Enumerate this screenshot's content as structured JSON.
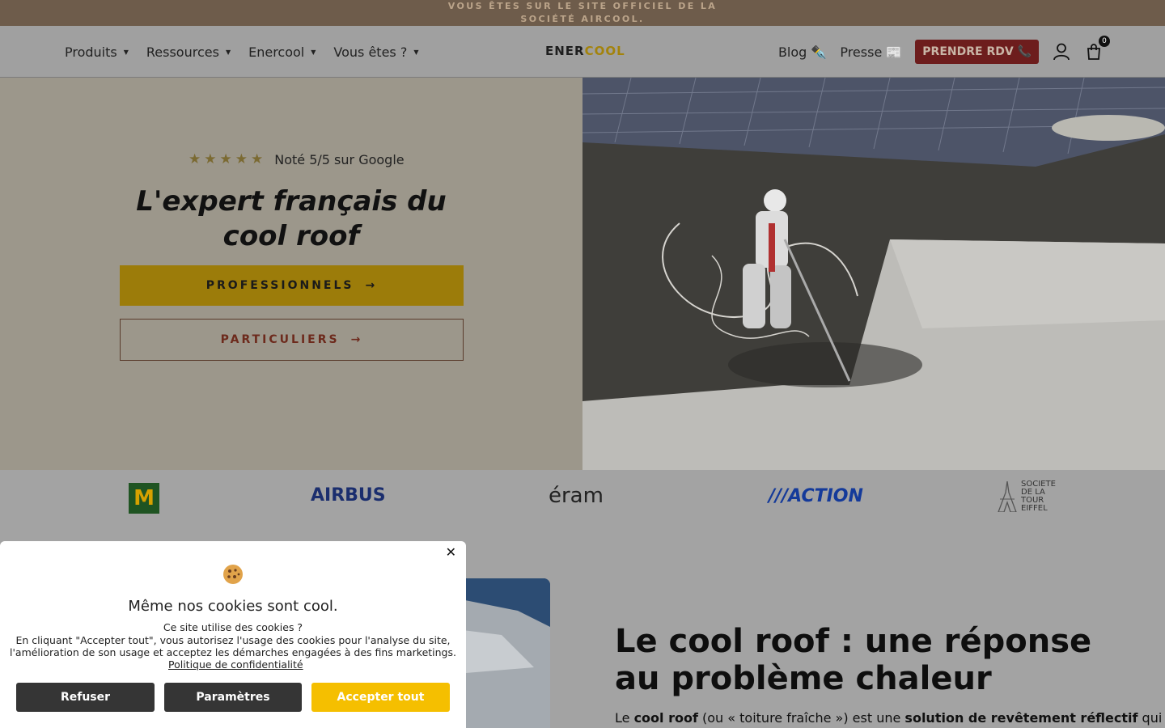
{
  "top_banner": {
    "text": "Vous êtes sur le site officiel de la société AIRCOOL."
  },
  "header": {
    "nav": [
      {
        "label": "Produits"
      },
      {
        "label": "Ressources"
      },
      {
        "label": "Enercool"
      },
      {
        "label": "Vous êtes ?"
      }
    ],
    "logo": {
      "part1": "ENER",
      "part2": "COOL"
    },
    "blog_label": "Blog ✒️",
    "presse_label": "Presse 📰",
    "rdv_label": "PRENDRE RDV 📞",
    "cart_count": "0"
  },
  "hero": {
    "rating_text": "Noté 5/5 sur Google",
    "title": "L'expert français du cool roof",
    "btn_pro": "PROFESSIONNELS",
    "btn_part": "PARTICULIERS"
  },
  "logos": {
    "mcdonalds": "M",
    "airbus": "AIRBUS",
    "eram": "éram",
    "action": "///ACTION",
    "eiffel": "SOCIETE DE LA TOUR EIFFEL"
  },
  "section": {
    "title": "Le cool roof : une réponse au problème chaleur",
    "text_prefix": "Le ",
    "text_b1": "cool roof",
    "text_mid": " (ou « toiture fraîche ») est une ",
    "text_b2": "solution de revêtement réflectif",
    "text_suffix": " qui"
  },
  "cookie": {
    "title": "Même nos cookies sont cool.",
    "question": "Ce site utilise des cookies ?",
    "body": "En cliquant \"Accepter tout\", vous autorisez l'usage des cookies pour l'analyse du site, l'amélioration de son usage et acceptez les démarches engagées à des fins marketings.",
    "policy": "Politique de confidentialité",
    "refuse": "Refuser",
    "params": "Paramètres",
    "accept": "Accepter tout"
  },
  "colors": {
    "accent_gold": "#9c7c0a",
    "cookie_accept": "#f5bf00",
    "rdv_button": "#6d1d1d",
    "banner": "#6e5c4b"
  }
}
